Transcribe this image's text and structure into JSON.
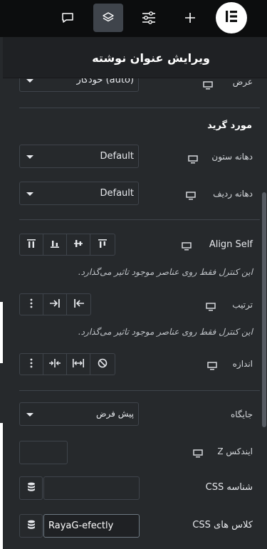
{
  "topbar": {
    "icons": [
      "comment-icon",
      "layers-icon",
      "sliders-icon",
      "plus-icon",
      "elementor-logo-icon"
    ]
  },
  "header": {
    "title": "ویرایش عنوان نوشته"
  },
  "cutoff": {
    "label": "عرض",
    "value": "خودکار (auto)"
  },
  "grid_item": {
    "title": "مورد گرید",
    "column_gap_label": "دهانه ستون",
    "column_gap_value": "Default",
    "row_gap_label": "دهانه ردیف",
    "row_gap_value": "Default"
  },
  "align_self": {
    "label": "Align Self",
    "note": "این کنترل فقط روی عناصر موجود تاثیر می‌گذارد."
  },
  "order": {
    "label": "ترتیب",
    "note": "این کنترل فقط روی عناصر موجود تاثیر می‌گذارد."
  },
  "size": {
    "label": "اندازه"
  },
  "position": {
    "label": "جایگاه",
    "value": "پیش فرض"
  },
  "z_index": {
    "label": "ایندکس Z",
    "value": ""
  },
  "css_id": {
    "label": "شناسه CSS",
    "value": ""
  },
  "css_classes": {
    "label": "کلاس های CSS",
    "value": "RayaG-efectly"
  },
  "colors": {
    "panel": "#26292c",
    "topbar": "#0c0d0e",
    "border": "#3f444b",
    "text": "#e7e9ed"
  }
}
